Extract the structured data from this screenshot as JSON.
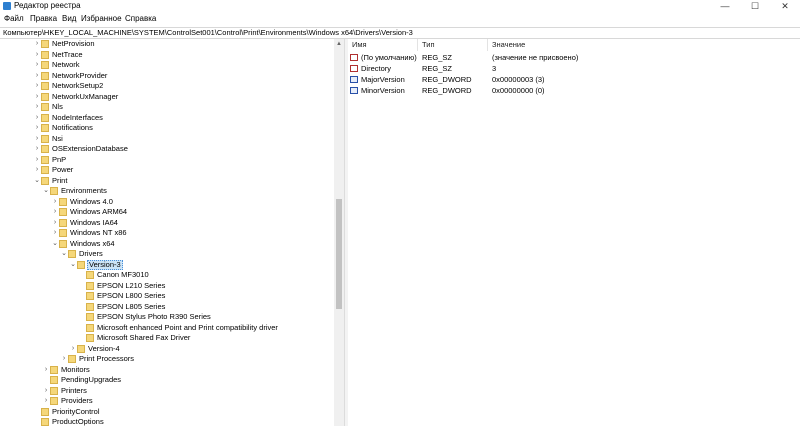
{
  "window": {
    "title": "Редактор реестра",
    "controls": {
      "minimize": "—",
      "maximize": "☐",
      "close": "✕"
    }
  },
  "menu": [
    "Файл",
    "Правка",
    "Вид",
    "Избранное",
    "Справка"
  ],
  "address": "Компьютер\\HKEY_LOCAL_MACHINE\\SYSTEM\\ControlSet001\\Control\\Print\\Environments\\Windows x64\\Drivers\\Version-3",
  "tree": [
    {
      "label": "NetProvision",
      "level": 2,
      "expander": "›"
    },
    {
      "label": "NetTrace",
      "level": 2,
      "expander": "›"
    },
    {
      "label": "Network",
      "level": 2,
      "expander": "›"
    },
    {
      "label": "NetworkProvider",
      "level": 2,
      "expander": "›"
    },
    {
      "label": "NetworkSetup2",
      "level": 2,
      "expander": "›"
    },
    {
      "label": "NetworkUxManager",
      "level": 2,
      "expander": "›"
    },
    {
      "label": "Nls",
      "level": 2,
      "expander": "›"
    },
    {
      "label": "NodeInterfaces",
      "level": 2,
      "expander": "›"
    },
    {
      "label": "Notifications",
      "level": 2,
      "expander": "›"
    },
    {
      "label": "Nsi",
      "level": 2,
      "expander": "›"
    },
    {
      "label": "OSExtensionDatabase",
      "level": 2,
      "expander": "›"
    },
    {
      "label": "PnP",
      "level": 2,
      "expander": "›"
    },
    {
      "label": "Power",
      "level": 2,
      "expander": "›"
    },
    {
      "label": "Print",
      "level": 2,
      "expander": "⌄"
    },
    {
      "label": "Environments",
      "level": 3,
      "expander": "⌄"
    },
    {
      "label": "Windows 4.0",
      "level": 4,
      "expander": "›"
    },
    {
      "label": "Windows ARM64",
      "level": 4,
      "expander": "›"
    },
    {
      "label": "Windows IA64",
      "level": 4,
      "expander": "›"
    },
    {
      "label": "Windows NT x86",
      "level": 4,
      "expander": "›"
    },
    {
      "label": "Windows x64",
      "level": 4,
      "expander": "⌄"
    },
    {
      "label": "Drivers",
      "level": 5,
      "expander": "⌄"
    },
    {
      "label": "Version-3",
      "level": 6,
      "expander": "⌄",
      "selected": true
    },
    {
      "label": "Canon MF3010",
      "level": 7,
      "expander": ""
    },
    {
      "label": "EPSON L210 Series",
      "level": 7,
      "expander": ""
    },
    {
      "label": "EPSON L800 Series",
      "level": 7,
      "expander": ""
    },
    {
      "label": "EPSON L805 Series",
      "level": 7,
      "expander": ""
    },
    {
      "label": "EPSON Stylus Photo R390 Series",
      "level": 7,
      "expander": ""
    },
    {
      "label": "Microsoft enhanced Point and Print compatibility driver",
      "level": 7,
      "expander": ""
    },
    {
      "label": "Microsoft Shared Fax Driver",
      "level": 7,
      "expander": ""
    },
    {
      "label": "Version-4",
      "level": 6,
      "expander": "›"
    },
    {
      "label": "Print Processors",
      "level": 5,
      "expander": "›"
    },
    {
      "label": "Monitors",
      "level": 3,
      "expander": "›"
    },
    {
      "label": "PendingUpgrades",
      "level": 3,
      "expander": ""
    },
    {
      "label": "Printers",
      "level": 3,
      "expander": "›"
    },
    {
      "label": "Providers",
      "level": 3,
      "expander": "›"
    },
    {
      "label": "PriorityControl",
      "level": 2,
      "expander": ""
    },
    {
      "label": "ProductOptions",
      "level": 2,
      "expander": ""
    }
  ],
  "values_table": {
    "headers": [
      "Имя",
      "Тип",
      "Значение"
    ],
    "rows": [
      {
        "name": "(По умолчанию)",
        "type": "REG_SZ",
        "data": "(значение не присвоено)",
        "icon": "string-value-icon"
      },
      {
        "name": "Directory",
        "type": "REG_SZ",
        "data": "3",
        "icon": "string-value-icon"
      },
      {
        "name": "MajorVersion",
        "type": "REG_DWORD",
        "data": "0x00000003 (3)",
        "icon": "dword-value-icon"
      },
      {
        "name": "MinorVersion",
        "type": "REG_DWORD",
        "data": "0x00000000 (0)",
        "icon": "dword-value-icon"
      }
    ]
  }
}
